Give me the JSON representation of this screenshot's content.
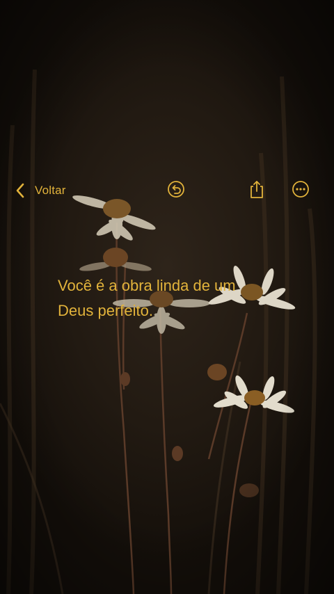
{
  "toolbar": {
    "back_label": "Voltar",
    "icons": [
      "chevron-left-icon",
      "undo-icon",
      "share-icon",
      "more-icon"
    ],
    "accent_color": "#e2b33b"
  },
  "note": {
    "text": "Você é a obra linda de um\nDeus perfeito."
  }
}
